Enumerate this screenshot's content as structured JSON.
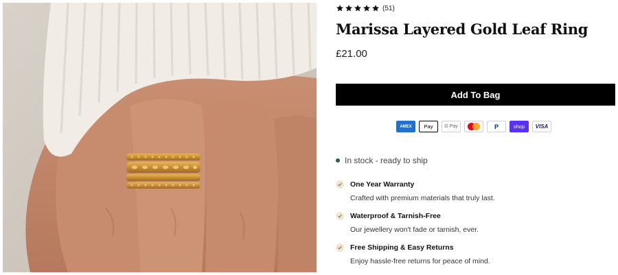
{
  "product": {
    "title": "Marissa Layered Gold Leaf Ring",
    "price": "£21.00",
    "rating_stars": 5,
    "review_count": "(51)",
    "image_icon": "ring-on-hand-photo"
  },
  "buttons": {
    "add_to_bag": "Add To Bag"
  },
  "payment_methods": [
    {
      "name": "amex",
      "label": "AMEX"
    },
    {
      "name": "applepay",
      "label": " Pay"
    },
    {
      "name": "googlepay",
      "label": "G Pay"
    },
    {
      "name": "mastercard",
      "label": ""
    },
    {
      "name": "paypal",
      "label": "P"
    },
    {
      "name": "shoppay",
      "label": "shop"
    },
    {
      "name": "visa",
      "label": "VISA"
    }
  ],
  "stock": {
    "text": "In stock - ready to ship",
    "color": "#2e5a4c"
  },
  "features": [
    {
      "title": "One Year Warranty",
      "description": "Crafted with premium materials that truly last."
    },
    {
      "title": "Waterproof & Tarnish-Free",
      "description": "Our jewellery won't fade or tarnish, ever."
    },
    {
      "title": "Free Shipping & Easy Returns",
      "description": "Enjoy hassle-free returns for peace of mind."
    }
  ],
  "colors": {
    "button_bg": "#000000",
    "button_text": "#ffffff",
    "star": "#111111",
    "check_bg": "#efe6d8"
  }
}
